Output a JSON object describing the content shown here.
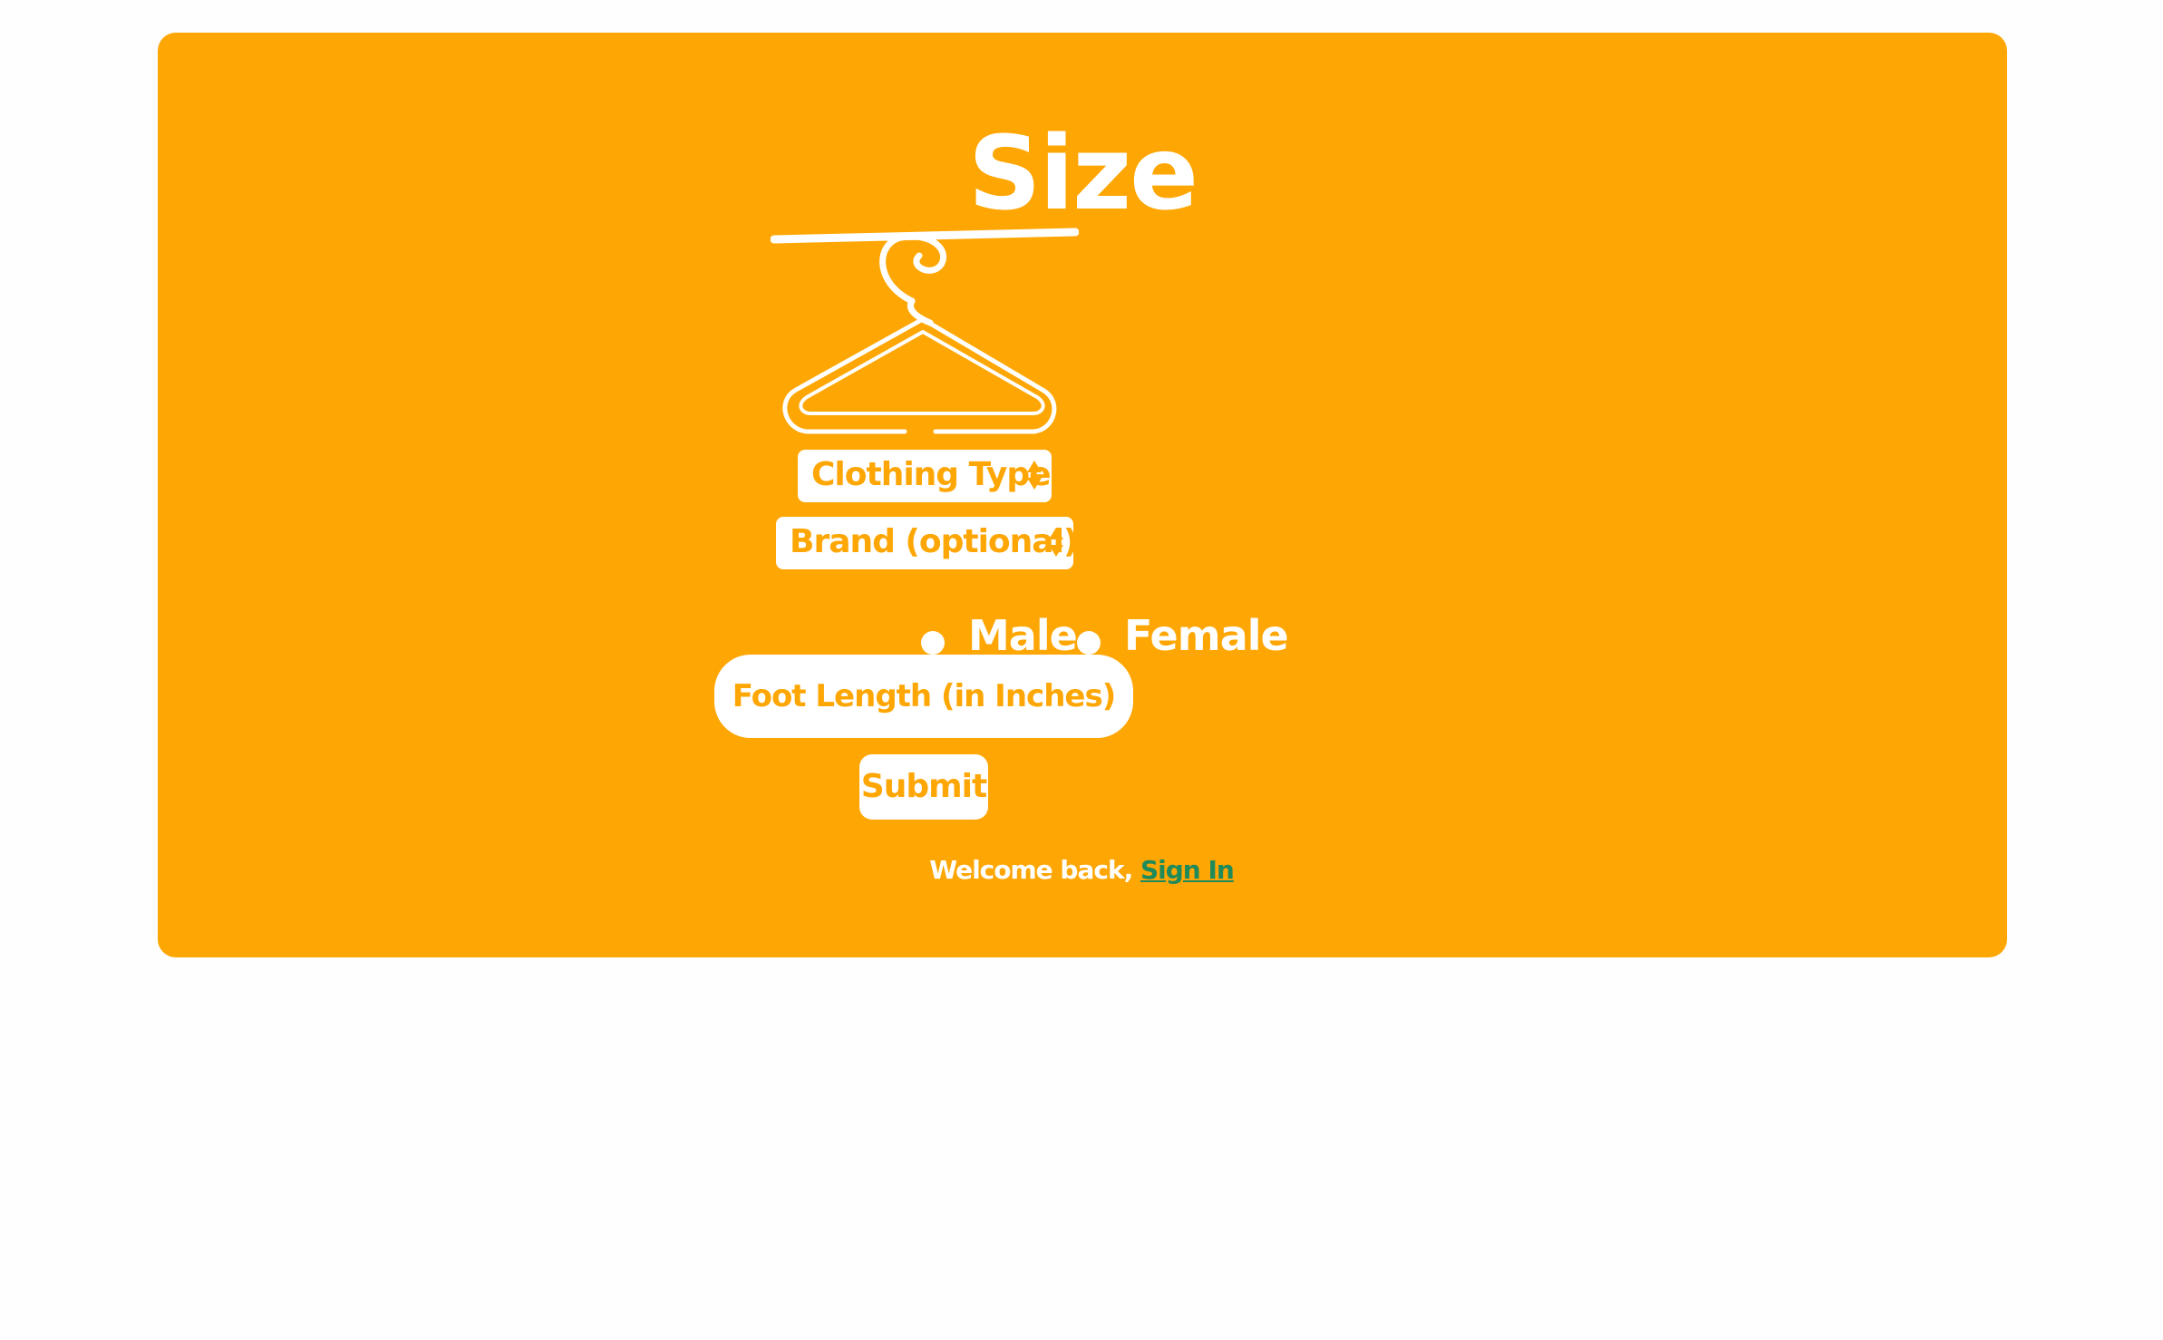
{
  "page": {
    "title": "Size",
    "accent_color": "#fea603",
    "link_color": "#1f8a5a",
    "icon": "clothes-hanger-icon"
  },
  "form": {
    "clothing_type": {
      "selected": "Clothing Type"
    },
    "brand": {
      "selected": "Brand (optional)"
    },
    "gender": {
      "options": [
        "Male",
        "Female"
      ],
      "selected": null
    },
    "foot_length": {
      "placeholder": "Foot Length (in Inches)",
      "value": ""
    },
    "submit_label": "Submit"
  },
  "footer": {
    "welcome_text": "Welcome back, ",
    "sign_in_label": "Sign In"
  }
}
